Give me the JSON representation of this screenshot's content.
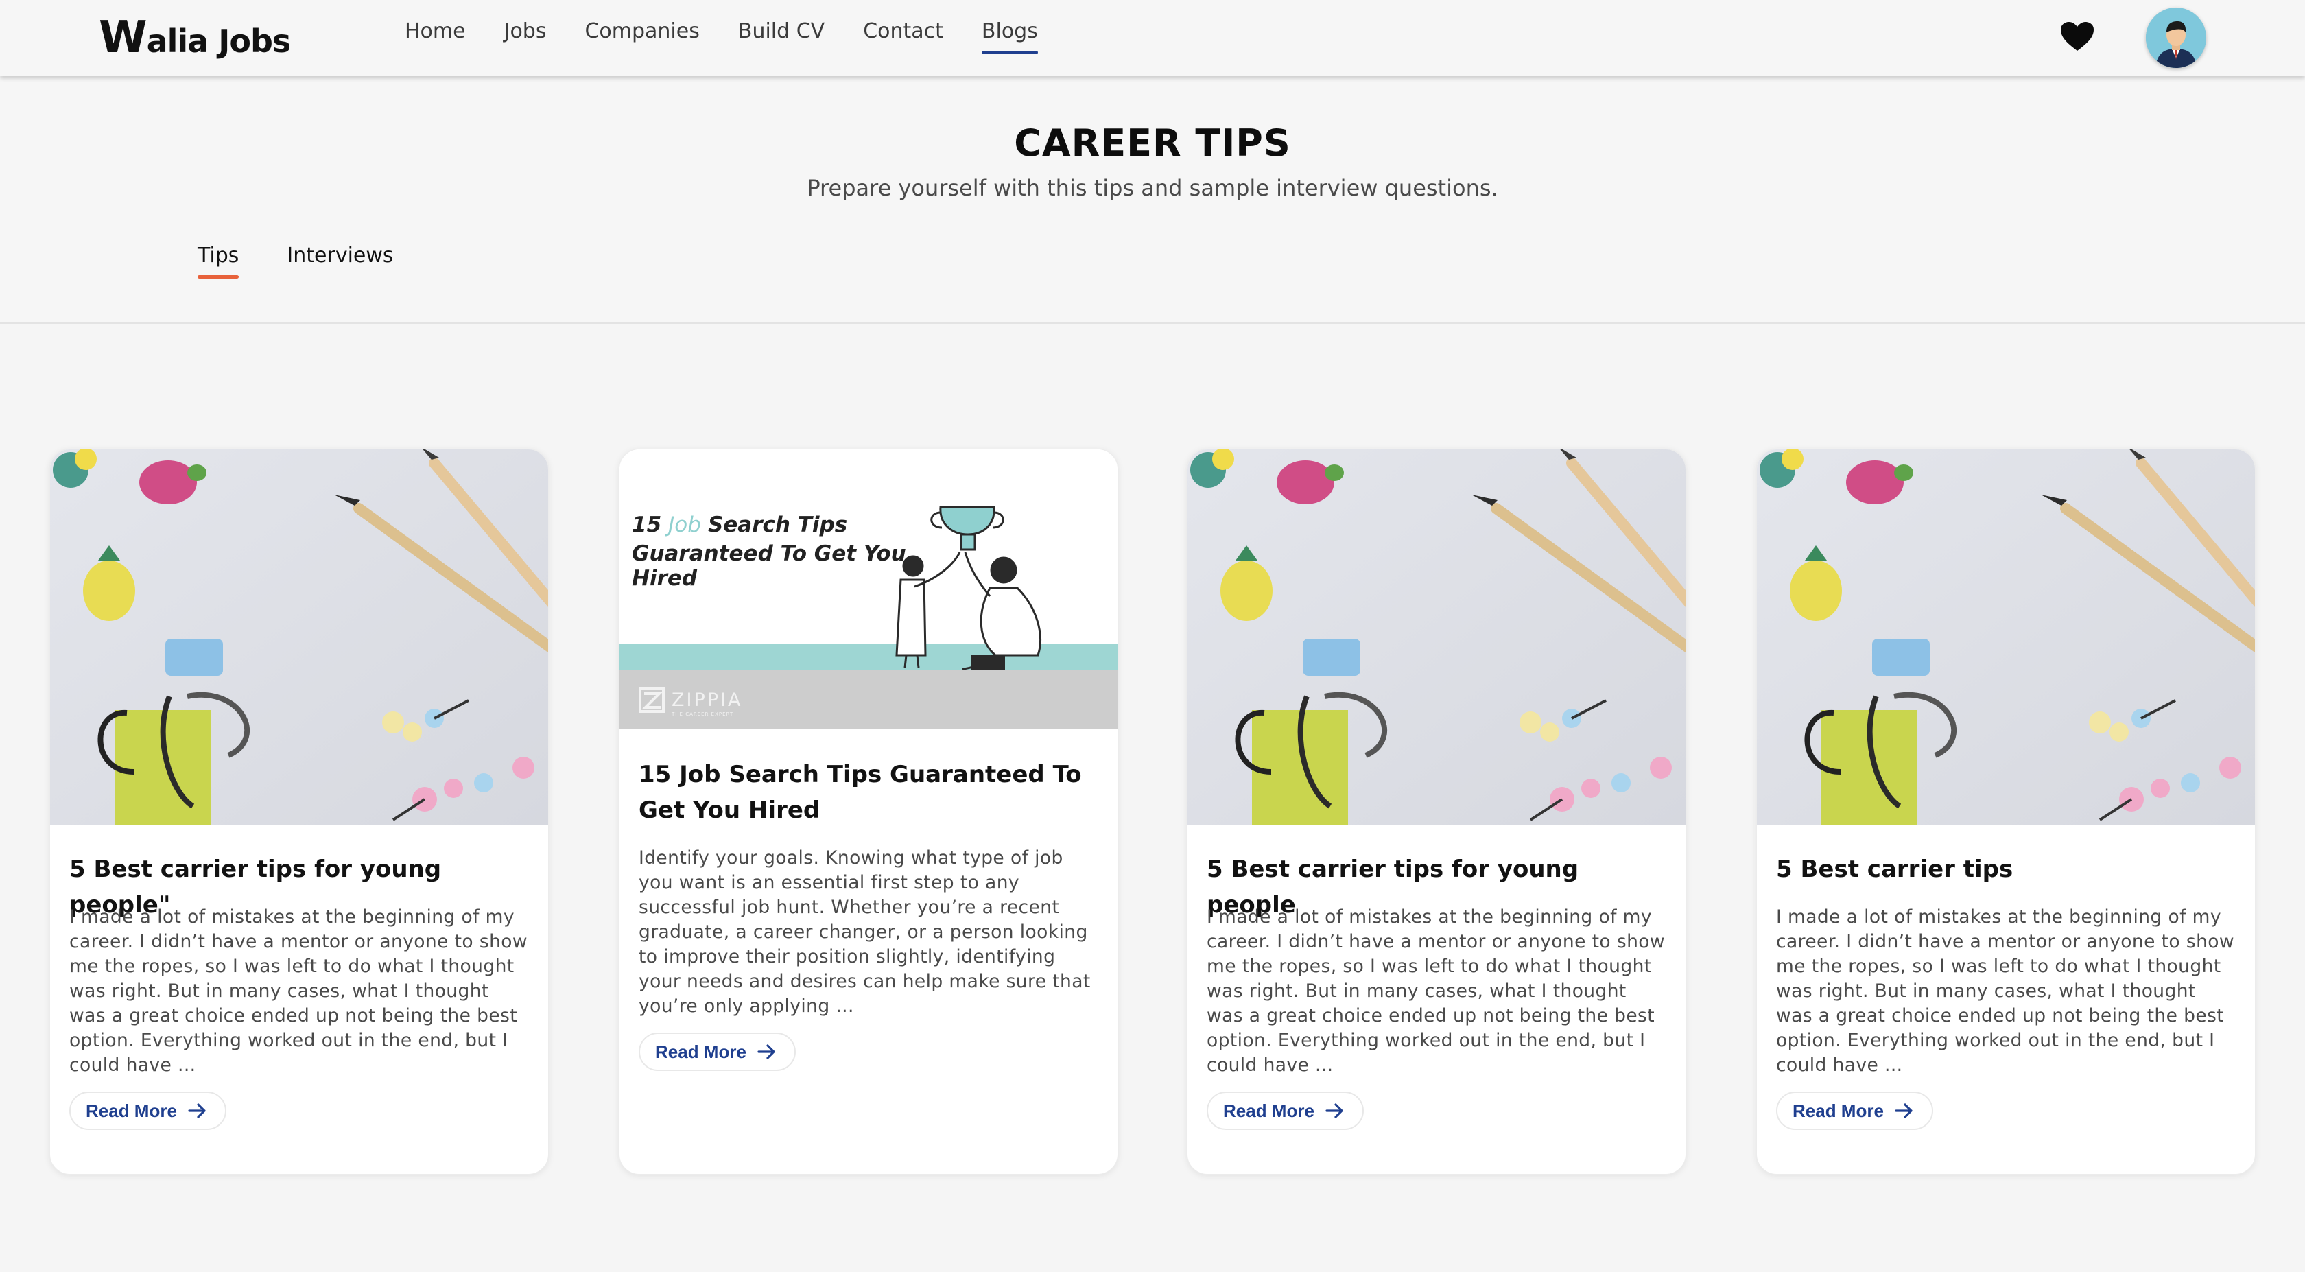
{
  "header": {
    "logo_w": "W",
    "logo_rest": "alia Jobs",
    "nav": [
      {
        "label": "Home"
      },
      {
        "label": "Jobs"
      },
      {
        "label": "Companies"
      },
      {
        "label": "Build CV"
      },
      {
        "label": "Contact"
      },
      {
        "label": "Blogs",
        "active": true
      }
    ],
    "favorites_icon": "heart-icon",
    "avatar_icon": "user-avatar"
  },
  "intro": {
    "title": "CAREER TIPS",
    "subtitle": "Prepare yourself with this tips and sample interview questions.",
    "tabs": [
      {
        "label": "Tips",
        "active": true
      },
      {
        "label": "Interviews"
      }
    ]
  },
  "colors": {
    "accent_nav": "#1f3f8f",
    "accent_tab": "#e8623b",
    "button_text": "#1f3f8f",
    "banner_teal": "#9ed6d3"
  },
  "cards": [
    {
      "title": "5 Best carrier tips for young people\"",
      "excerpt": "I made a lot of mistakes at the beginning of my career. I didn’t have a mentor or anyone to show me the ropes, so I was left to do what I thought was right. But in many cases, what I thought was a great choice ended up not being the best option. Everything worked out in the end, but I could have ...",
      "button": "Read More"
    },
    {
      "title": "15 Job Search Tips Guaranteed To Get You Hired",
      "excerpt": "Identify your goals. Knowing what type of job you want is an essential first step to any successful job hunt. Whether you’re a recent graduate, a career changer, or a person looking to improve their position slightly, identifying your needs and desires can help make sure that you’re only applying ...",
      "button": "Read More",
      "banner": {
        "line1_num": "15",
        "line1_job": "Job",
        "line1_rest": "Search Tips",
        "line2": "Guaranteed To Get You",
        "line3": "Hired",
        "brand": "ZIPPIA",
        "brand_tagline": "THE CAREER EXPERT"
      }
    },
    {
      "title": "5 Best carrier tips for young people",
      "excerpt": "I made a lot of mistakes at the beginning of my career. I didn’t have a mentor or anyone to show me the ropes, so I was left to do what I thought was right. But in many cases, what I thought was a great choice ended up not being the best option. Everything worked out in the end, but I could have ...",
      "button": "Read More"
    },
    {
      "title": "5 Best carrier tips",
      "excerpt": "I made a lot of mistakes at the beginning of my career. I didn’t have a mentor or anyone to show me the ropes, so I was left to do what I thought was right. But in many cases, what I thought was a great choice ended up not being the best option. Everything worked out in the end, but I could have ...",
      "button": "Read More"
    }
  ]
}
